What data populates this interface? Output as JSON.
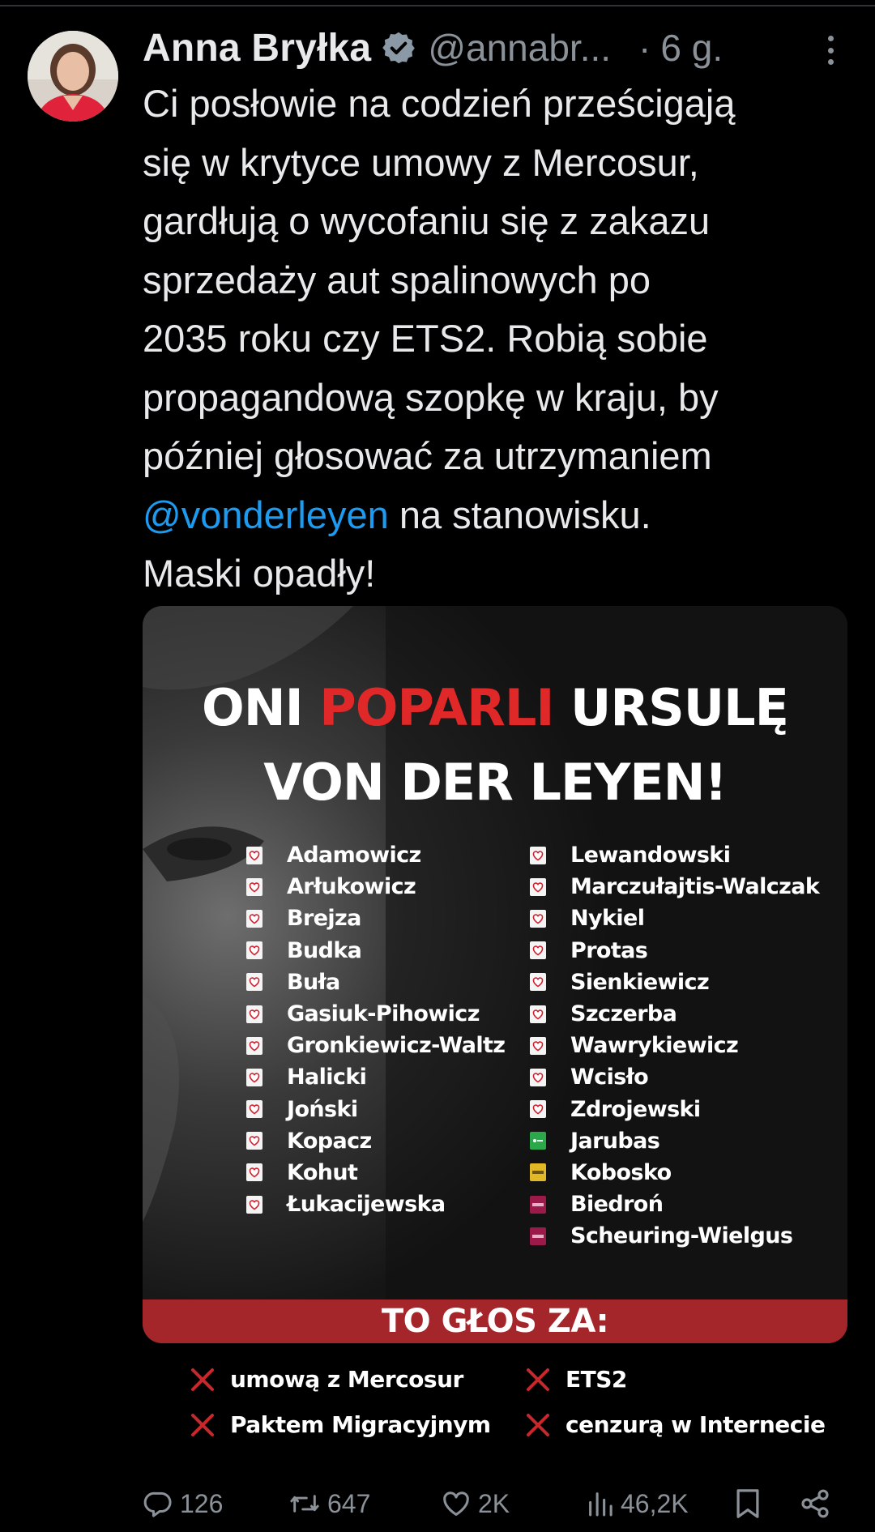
{
  "tweet": {
    "author_name": "Anna Bryłka",
    "handle": "@annabr...",
    "separator": "·",
    "time": "6 g.",
    "text_lines": [
      "Ci posłowie na codzień prześcigają",
      "się w krytyce umowy z Mercosur,",
      "gardłują o wycofaniu się z zakazu",
      "sprzedaży aut spalinowych po",
      "2035 roku czy ETS2. Robią sobie",
      "propagandową szopkę w kraju, by",
      "później głosować za utrzymaniem"
    ],
    "mention": "@vonderleyen",
    "mention_suffix": " na stanowisku.",
    "last_line": "Maski opadły!"
  },
  "poster": {
    "title_line1_a": "ONI ",
    "title_line1_red": "POPARLI",
    "title_line1_b": " URSULĘ",
    "title_line2": "VON DER LEYEN!",
    "left_names": [
      "Adamowicz",
      "Arłukowicz",
      "Brejza",
      "Budka",
      "Buła",
      "Gasiuk-Pihowicz",
      "Gronkiewicz-Waltz",
      "Halicki",
      "Joński",
      "Kopacz",
      "Kohut",
      "Łukacijewska"
    ],
    "right_names": [
      "Lewandowski",
      "Marczułajtis-Walczak",
      "Nykiel",
      "Protas",
      "Sienkiewicz",
      "Szczerba",
      "Wawrykiewicz",
      "Wcisło",
      "Zdrojewski",
      "Jarubas",
      "Kobosko",
      "Biedroń",
      "Scheuring-Wielgus"
    ],
    "right_party_icons": [
      "ko",
      "ko",
      "ko",
      "ko",
      "ko",
      "ko",
      "ko",
      "ko",
      "ko",
      "psl",
      "p2050",
      "lew",
      "lew"
    ],
    "banner": "TO GŁOS ZA:",
    "votes": [
      "umową z Mercosur",
      "ETS2",
      "Paktem Migracyjnym",
      "cenzurą w Internecie"
    ]
  },
  "actions": {
    "replies": "126",
    "reposts": "647",
    "likes": "2K",
    "views": "46,2K"
  },
  "colors": {
    "accent_blue": "#1d9bf0",
    "muted_text": "#8b9198",
    "poster_red": "#e02828",
    "banner_red": "#a5262a"
  }
}
